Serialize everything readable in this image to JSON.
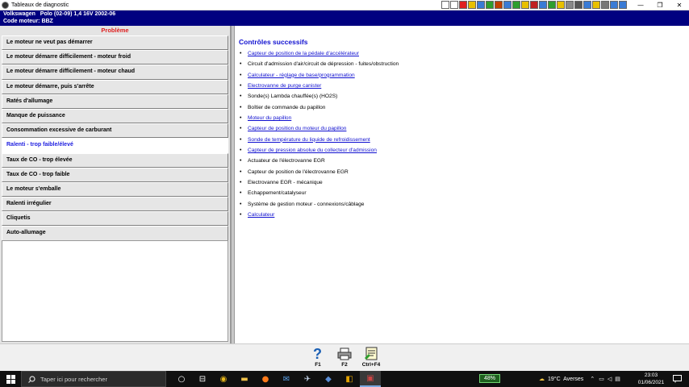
{
  "window": {
    "title": "Tableaux de diagnostic"
  },
  "toolbar_icons": [
    "first-record-icon",
    "previous-icon",
    "warning-icon",
    "book-icon",
    "database-icon",
    "chart-icon",
    "tool-icon",
    "document-icon",
    "table-icon",
    "grid-icon",
    "flag-icon",
    "calendar-icon",
    "wrench-icon",
    "note-icon",
    "engine-icon",
    "cog-icon",
    "list-icon",
    "circuit-icon",
    "settings-icon",
    "window-icon",
    "help-icon"
  ],
  "vehicle": {
    "line1": "Volkswagen   Polo (02-09) 1,4 16V 2002-06",
    "line2": "Code moteur: BBZ"
  },
  "left": {
    "header": "Problème",
    "problems": [
      "Le moteur ne veut pas démarrer",
      "Le moteur démarre difficilement - moteur froid",
      "Le moteur démarre difficilement - moteur chaud",
      "Le moteur démarre, puis s'arrête",
      "Ratés d'allumage",
      "Manque de puissance",
      "Consommation excessive de carburant",
      "Ralenti - trop faible/élevé",
      "Taux de CO - trop élevée",
      "Taux de CO - trop faible",
      "Le moteur s'emballe",
      "Ralenti irrégulier",
      "Cliquetis",
      "Auto-allumage"
    ],
    "selected_index": 7
  },
  "right": {
    "title": "Contrôles successifs",
    "checks": [
      {
        "text": "Capteur de position de la pédale d'accélérateur",
        "link": true
      },
      {
        "text": "Circuit d'admission d'air/circuit de dépression - fuites/obstruction",
        "link": false
      },
      {
        "text": "Calculateur - réglage de base/programmation",
        "link": true
      },
      {
        "text": "Electrovanne de purge canister",
        "link": true
      },
      {
        "text": "Sonde(s) Lambda chauffée(s) (HO2S)",
        "link": false
      },
      {
        "text": "Boîtier de commande du papillon",
        "link": false
      },
      {
        "text": "Moteur du papillon",
        "link": true
      },
      {
        "text": "Capteur de position du moteur du papillon",
        "link": true
      },
      {
        "text": "Sonde de température du liquide de refroidissement",
        "link": true
      },
      {
        "text": "Capteur de pression absolue du collecteur d'admission",
        "link": true
      },
      {
        "text": "Actuateur de l'électrovanne EGR",
        "link": false
      },
      {
        "text": "Capteur de position de l'électrovanne EGR",
        "link": false
      },
      {
        "text": "Electrovanne EGR - mécanique",
        "link": false
      },
      {
        "text": "Echappement/catalyseur",
        "link": false
      },
      {
        "text": "Système de gestion moteur - connexions/câblage",
        "link": false
      },
      {
        "text": "Calculateur",
        "link": true
      }
    ]
  },
  "fkeys": [
    {
      "label": "F1",
      "icon": "help-icon"
    },
    {
      "label": "F2",
      "icon": "printer-icon"
    },
    {
      "label": "Ctrl+F4",
      "icon": "notes-icon"
    }
  ],
  "taskbar": {
    "search_placeholder": "Taper ici pour rechercher",
    "battery": "48%",
    "weather": "19°C  Averses",
    "time": "23:03",
    "date": "01/06/2021"
  },
  "colors": {
    "accent": "#000080",
    "link": "#1010d0",
    "header_red": "#e02020"
  }
}
